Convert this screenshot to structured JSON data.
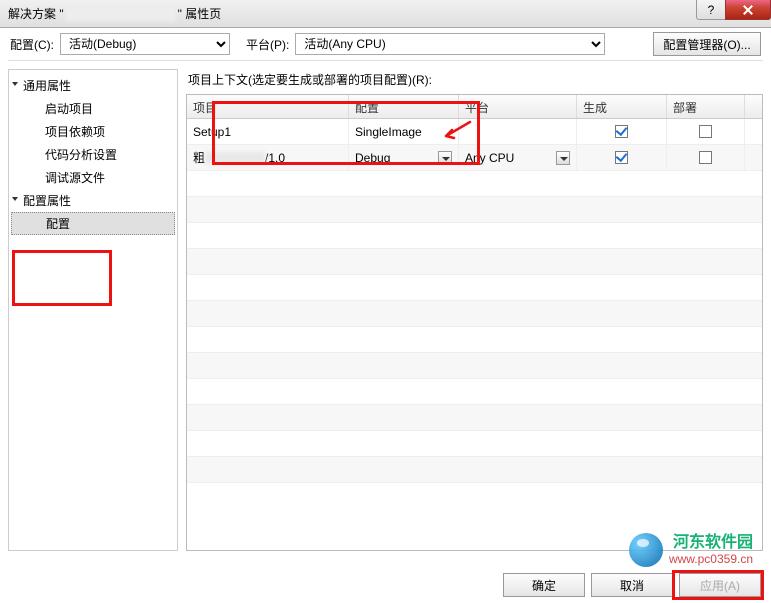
{
  "title": {
    "prefix": "解决方案",
    "suffix": "属性页"
  },
  "winControls": {
    "help": "?"
  },
  "topRow": {
    "configLabel": "配置(C):",
    "configValue": "活动(Debug)",
    "platformLabel": "平台(P):",
    "platformValue": "活动(Any CPU)",
    "managerBtn": "配置管理器(O)..."
  },
  "tree": {
    "common": "通用属性",
    "startup": "启动项目",
    "deps": "项目依赖项",
    "analysis": "代码分析设置",
    "debugSrc": "调试源文件",
    "configProps": "配置属性",
    "config": "配置"
  },
  "context": {
    "label": "项目上下文(选定要生成或部署的项目配置)(R):"
  },
  "headers": {
    "project": "项目",
    "config": "配置",
    "platform": "平台",
    "build": "生成",
    "deploy": "部署"
  },
  "rows": [
    {
      "project": "Setup1",
      "config": "SingleImage",
      "platform": "",
      "build": true,
      "deploy": false,
      "hasDropdown": false
    },
    {
      "projectPrefix": "粗",
      "projectSuffix": "/1.0",
      "config": "Debug",
      "platform": "Any CPU",
      "build": true,
      "deploy": false,
      "hasDropdown": true
    }
  ],
  "buttons": {
    "ok": "确定",
    "cancel": "取消",
    "apply": "应用(A)"
  },
  "watermark": {
    "cn": "河东软件园",
    "url": "www.pc0359.cn"
  }
}
